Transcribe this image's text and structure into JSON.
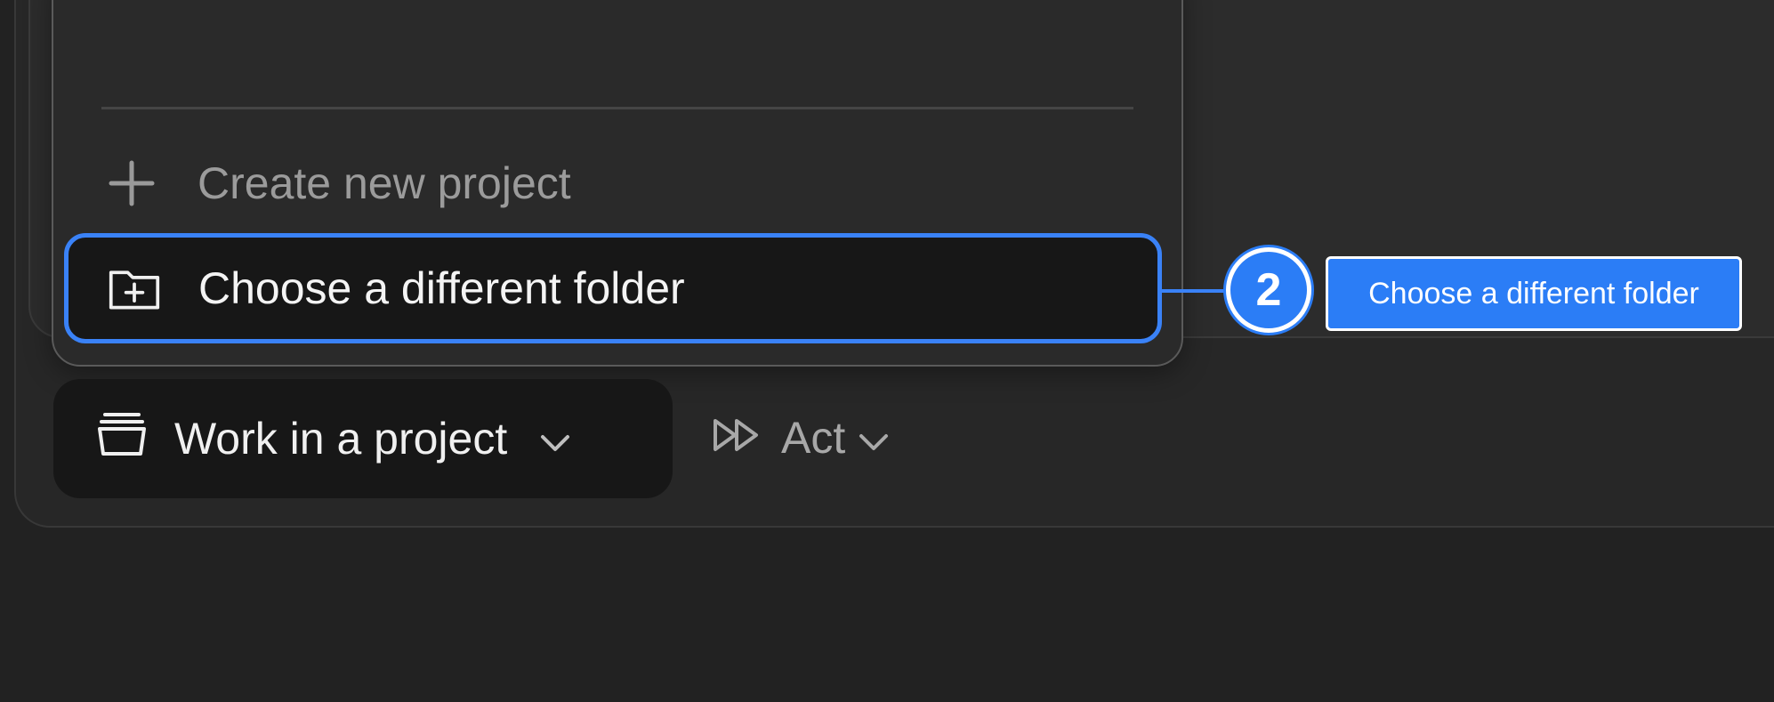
{
  "popup": {
    "create_label": "Create new project",
    "choose_label": "Choose a different folder"
  },
  "annotation": {
    "step_number": "2",
    "callout_text": "Choose a different folder",
    "accent_color": "#2b7df6"
  },
  "toolbar": {
    "project_label": "Work in a project",
    "mode_label": "Act"
  },
  "icons": {
    "create": "plus-icon",
    "choose": "folder-plus-icon",
    "project": "stack-icon",
    "mode": "fast-forward-icon",
    "dropdown": "chevron-down-icon"
  }
}
